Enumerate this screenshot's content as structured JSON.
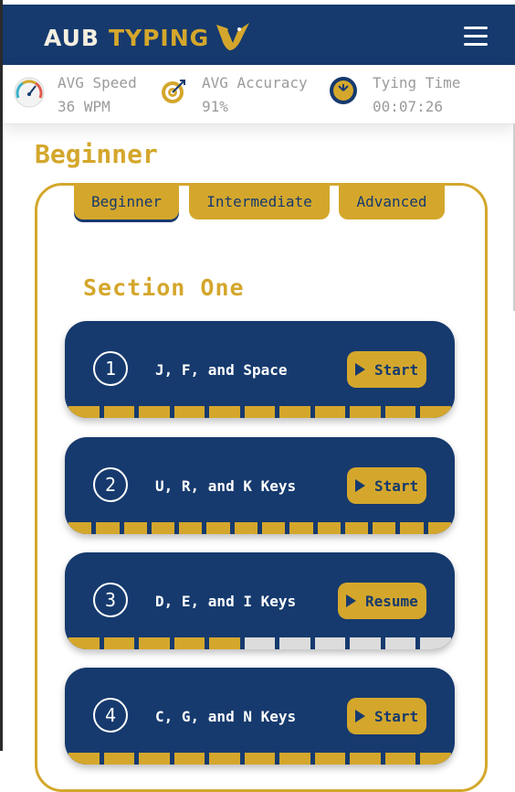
{
  "header": {
    "logo_text_a": "AUB",
    "logo_text_b": "TYPING",
    "menu_icon": "hamburger-icon",
    "colors": {
      "navy": "#163a6e",
      "gold": "#d4a72c"
    }
  },
  "stats": {
    "speed": {
      "label": "AVG Speed",
      "value": "36 WPM",
      "icon": "speedometer-icon"
    },
    "accuracy": {
      "label": "AVG Accuracy",
      "value": "91%",
      "icon": "target-icon"
    },
    "time": {
      "label": "Tying Time",
      "value": "00:07:26",
      "icon": "clock-icon"
    }
  },
  "page_title": "Beginner",
  "tabs": [
    {
      "label": "Beginner",
      "active": true
    },
    {
      "label": "Intermediate",
      "active": false
    },
    {
      "label": "Advanced",
      "active": false
    }
  ],
  "section_title": "Section One",
  "lessons": [
    {
      "number": "1",
      "title": "J, F, and Space",
      "button": "Start",
      "progress_total": 11,
      "progress_done": 11
    },
    {
      "number": "2",
      "title": "U, R, and K Keys",
      "button": "Start",
      "progress_total": 14,
      "progress_done": 14
    },
    {
      "number": "3",
      "title": "D, E, and I Keys",
      "button": "Resume",
      "progress_total": 11,
      "progress_done": 5
    },
    {
      "number": "4",
      "title": "C, G, and N Keys",
      "button": "Start",
      "progress_total": 11,
      "progress_done": 11
    }
  ]
}
